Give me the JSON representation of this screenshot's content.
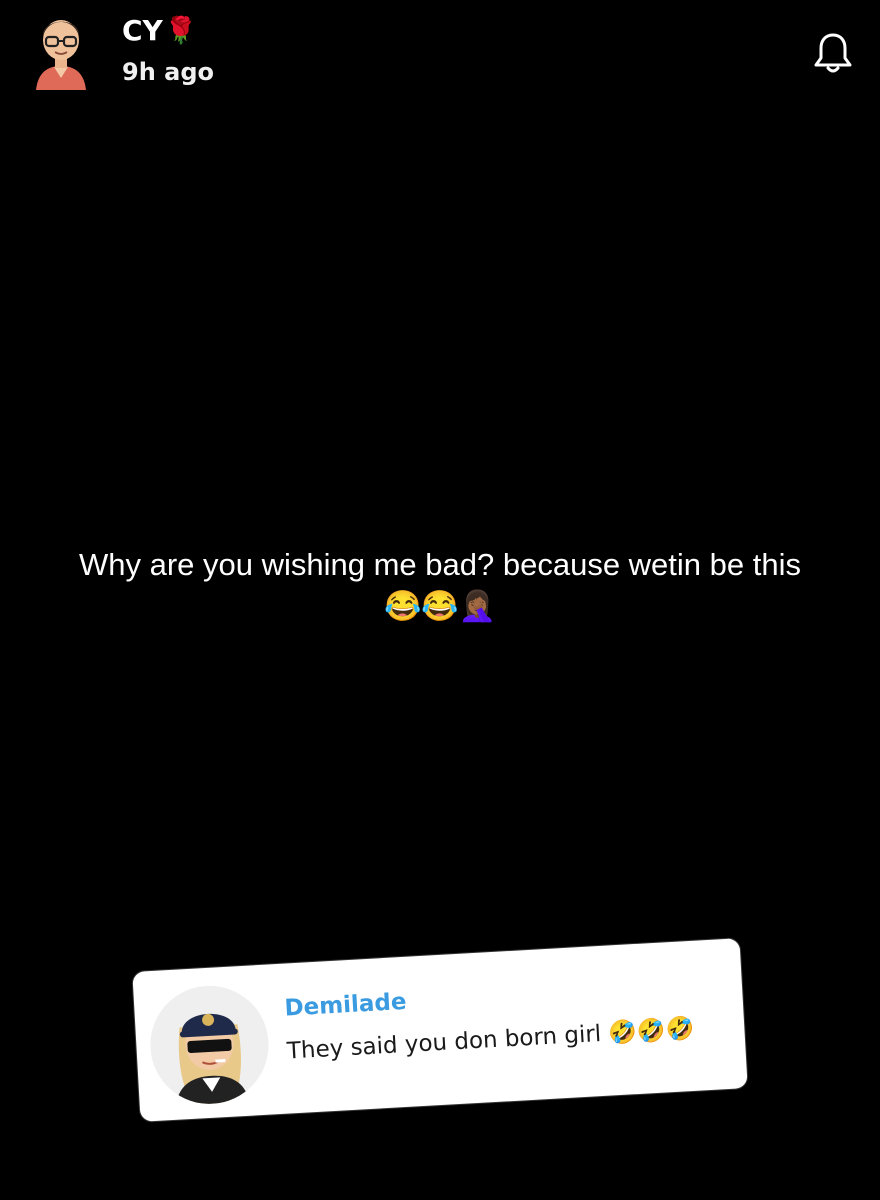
{
  "header": {
    "username": "CY",
    "username_emoji": "🌹",
    "time_ago": "9h ago",
    "avatar_icon": "bitmoji-avatar-icon",
    "notification_icon": "bell-icon"
  },
  "story": {
    "caption": "Why are you wishing me bad? because wetin be this",
    "caption_emojis": "😂😂🤦🏾‍♀️"
  },
  "reply": {
    "author": "Demilade",
    "text": "They said you don born girl",
    "emojis": "🤣🤣🤣",
    "avatar_icon": "bitmoji-avatar-icon"
  },
  "colors": {
    "background": "#000000",
    "reply_name": "#3a9be0",
    "card": "#ffffff"
  }
}
